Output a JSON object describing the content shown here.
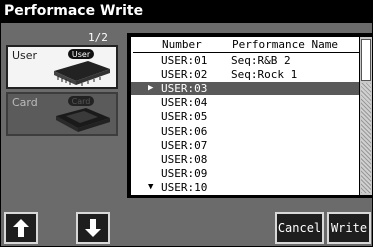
{
  "window": {
    "title": "Performace Write"
  },
  "media": {
    "page_indicator": "1/2",
    "user": {
      "label": "User",
      "badge": "User"
    },
    "card": {
      "label": "Card",
      "badge": "Card"
    }
  },
  "list": {
    "headers": {
      "number": "Number",
      "name": "Performance Name"
    },
    "rows": [
      {
        "number": "USER:01",
        "name": "Seq:R&B 2"
      },
      {
        "number": "USER:02",
        "name": "Seq:Rock 1"
      },
      {
        "number": "USER:03",
        "name": ""
      },
      {
        "number": "USER:04",
        "name": ""
      },
      {
        "number": "USER:05",
        "name": ""
      },
      {
        "number": "USER:06",
        "name": ""
      },
      {
        "number": "USER:07",
        "name": ""
      },
      {
        "number": "USER:08",
        "name": ""
      },
      {
        "number": "USER:09",
        "name": ""
      },
      {
        "number": "USER:10",
        "name": ""
      }
    ],
    "selected_index": 2,
    "current_marker": "▶",
    "more_marker": "▼"
  },
  "buttons": {
    "cancel": "Cancel",
    "write": "Write",
    "up_icon": "arrow-up-icon",
    "down_icon": "arrow-down-icon"
  },
  "colors": {
    "selected_row": "#5a5a5a",
    "title_bar": "#000000",
    "background": "#6b6b6b"
  }
}
